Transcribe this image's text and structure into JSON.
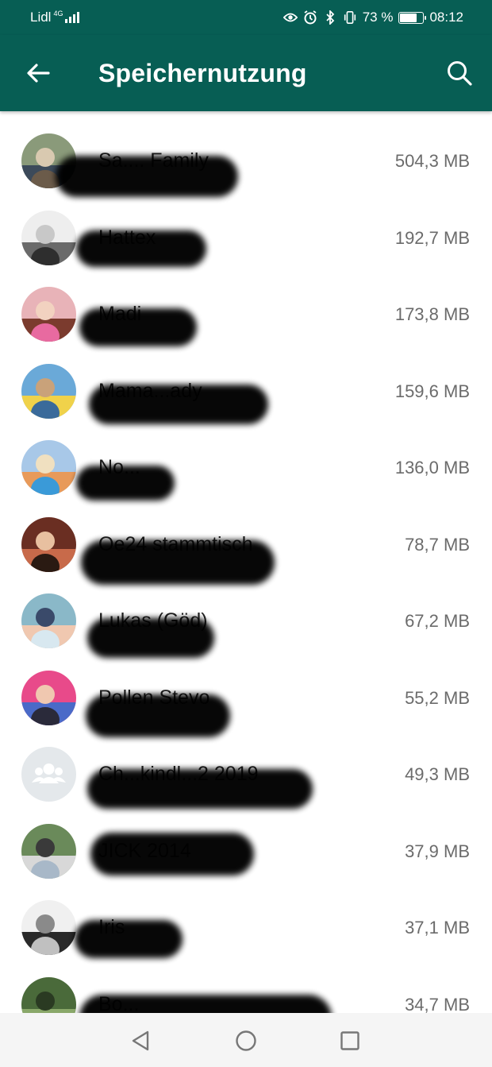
{
  "status_bar": {
    "carrier": "Lidl",
    "network_type": "4G",
    "battery_percent": "73 %",
    "battery_level": 0.73,
    "time": "08:12",
    "icons": [
      "eye-icon",
      "alarm-icon",
      "bluetooth-icon",
      "vibrate-icon"
    ]
  },
  "app_bar": {
    "title": "Speichernutzung",
    "back_icon": "arrow-left-icon",
    "search_icon": "search-icon"
  },
  "colors": {
    "primary": "#075e54",
    "size_text": "#6b6b6b",
    "name_text": "#202020"
  },
  "chats": [
    {
      "name": "Sa....  Family",
      "size": "504,3 MB"
    },
    {
      "name": "Hattex",
      "size": "192,7 MB"
    },
    {
      "name": "Madi",
      "size": "173,8 MB"
    },
    {
      "name": "Mama...ady",
      "size": "159,6 MB"
    },
    {
      "name": "No...",
      "size": "136,0 MB"
    },
    {
      "name": "Oe24 stammtisch",
      "size": "78,7 MB"
    },
    {
      "name": "Lukas (Göd)",
      "size": "67,2 MB"
    },
    {
      "name": "Pollen Stevo",
      "size": "55,2 MB"
    },
    {
      "name": "Ch...kindl...2 2019",
      "size": "49,3 MB"
    },
    {
      "name": "JICK 2014",
      "size": "37,9 MB"
    },
    {
      "name": "Iris",
      "size": "37,1 MB"
    },
    {
      "name": "Bo...",
      "size": "34,7 MB"
    }
  ],
  "nav_bar": {
    "icons": [
      "back-triangle-icon",
      "home-circle-icon",
      "recents-square-icon"
    ]
  }
}
